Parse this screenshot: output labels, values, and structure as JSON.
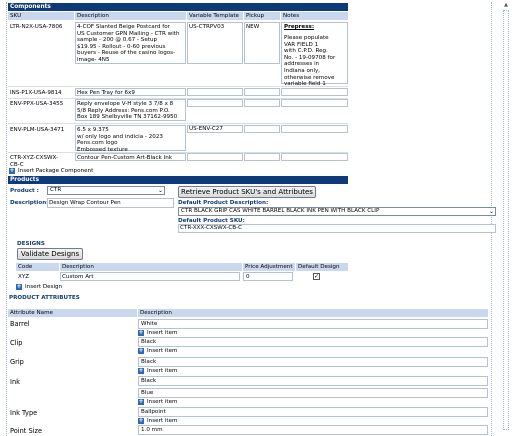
{
  "components": {
    "title": "Components",
    "headers": [
      "SKU",
      "Description",
      "Variable Template",
      "Pickup",
      "Notes"
    ],
    "rows": [
      {
        "sku": "LTR-N2X-USA-7806",
        "desc": "4-COF Slanted Beige Postcard for\nUS Customer GPN Mailing - CTR with\nsample - 200 @ 0.67 - Setup\n$19.95 - Rollout - 0-60 previous\nbuyers - Reuse of the casino logos-\nimage- 4N5",
        "template": "US-CTRPV03",
        "pickup": "NEW",
        "notes_heading": "Prepress:",
        "notes": "Please populate\nVAR FIELD 1\nwith C.P.D. Reg.\nNo. - 19-09708 for\naddresses in\nIndiana only,\notherwise remove\nvariable field 1"
      },
      {
        "sku": "INS-P1X-USA-9814",
        "desc": "Hex Pen Tray for 6x9",
        "template": "",
        "pickup": "",
        "notes_heading": "",
        "notes": ""
      },
      {
        "sku": "ENV-PPX-USA-3455",
        "desc": "Reply envelope V-H style 3 7/8 x 8\n5/8 Reply Address: Pens.com P.O.\nBox 189 Shelbyville TN 37162-9950",
        "template": "",
        "pickup": "",
        "notes_heading": "",
        "notes": ""
      },
      {
        "sku": "ENV-PLM-USA-3471",
        "desc": "6.5 x 9.375\nw/ only logo and indicia - 2023\nPens.com logo\nEmbossed texture",
        "template": "US-ENV-C27",
        "pickup": "",
        "notes_heading": "",
        "notes": ""
      },
      {
        "sku": "CTR-XYZ-CXSWX-\nCB-C",
        "desc": "Contour Pen-Custom Art-Black Ink",
        "template": "",
        "pickup": "",
        "notes_heading": "",
        "notes": ""
      }
    ],
    "insert_label": "Insert Package Component"
  },
  "products": {
    "title": "Products",
    "product_label": "Product :",
    "product_value": "CTR",
    "description_label": "Description:",
    "description_value": "Design Wrap Contour Pen",
    "retrieve_button": "Retrieve Product SKU's and Attributes",
    "default_desc_label": "Default Product Description:",
    "default_desc_value": "CTR BLACK GRIP CAS WHITE BARREL BLACK INK PEN WITH BLACK CLIP",
    "default_sku_label": "Default Product SKU:",
    "default_sku_value": "CTR-XXX-CXSWX-CB-C"
  },
  "designs": {
    "title": "DESIGNS",
    "validate_button": "Validate Designs",
    "headers": [
      "Code",
      "Description",
      "Price Adjustment",
      "Default Design"
    ],
    "row": {
      "code": "XYZ",
      "description": "Custom Art",
      "price": "0",
      "default_checked": true
    },
    "insert_label": "Insert Design"
  },
  "attributes": {
    "title": "PRODUCT ATTRIBUTES",
    "headers": [
      "Attribute Name",
      "Description"
    ],
    "insert_label": "Insert item",
    "items": [
      {
        "name": "Barrel",
        "values": [
          "White"
        ]
      },
      {
        "name": "Clip",
        "values": [
          "Black"
        ]
      },
      {
        "name": "Grip",
        "values": [
          "Black"
        ]
      },
      {
        "name": "Ink",
        "values": [
          "Black",
          "Blue"
        ]
      },
      {
        "name": "Ink Type",
        "values": [
          "Ballpoint"
        ]
      },
      {
        "name": "Point Size",
        "values": [
          "1.0 mm"
        ]
      }
    ]
  },
  "colors": {
    "header_bg": "#0f3a7a",
    "subheader_bg": "#c9d8ee",
    "accent": "#2e69b3"
  }
}
